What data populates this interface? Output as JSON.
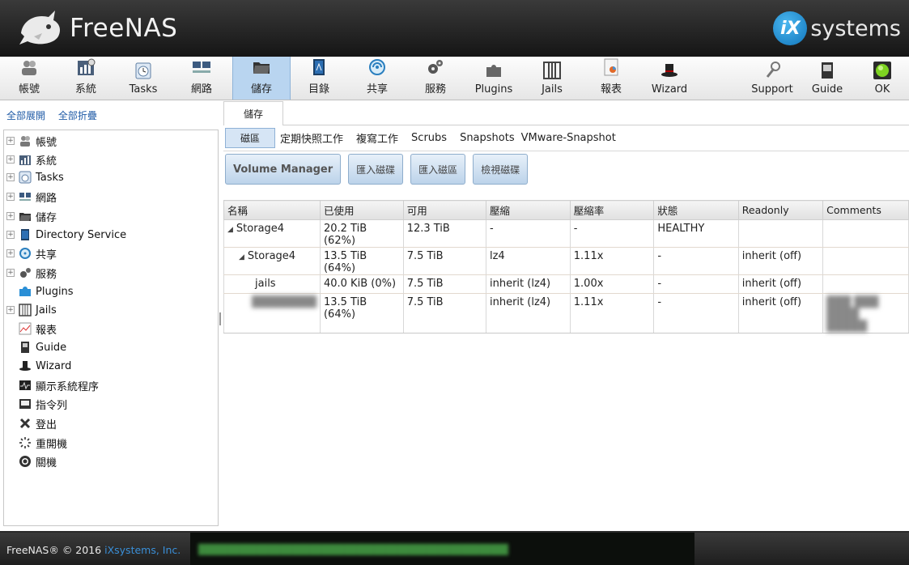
{
  "header": {
    "brand": "FreeNAS",
    "vendor_badge": "iX",
    "vendor_name": "systems"
  },
  "toolbar": {
    "items": [
      {
        "label": "帳號",
        "icon": "users-icon"
      },
      {
        "label": "系統",
        "icon": "system-icon"
      },
      {
        "label": "Tasks",
        "icon": "calendar-icon"
      },
      {
        "label": "網路",
        "icon": "network-icon"
      },
      {
        "label": "儲存",
        "icon": "folder-icon"
      },
      {
        "label": "目錄",
        "icon": "directory-icon"
      },
      {
        "label": "共享",
        "icon": "share-icon"
      },
      {
        "label": "服務",
        "icon": "gears-icon"
      },
      {
        "label": "Plugins",
        "icon": "puzzle-icon"
      },
      {
        "label": "Jails",
        "icon": "jail-icon"
      },
      {
        "label": "報表",
        "icon": "report-icon"
      },
      {
        "label": "Wizard",
        "icon": "wizard-hat-icon"
      },
      {
        "label": "Support",
        "icon": "support-icon"
      },
      {
        "label": "Guide",
        "icon": "guide-icon"
      },
      {
        "label": "OK",
        "icon": "alert-ok-icon"
      }
    ],
    "active": "儲存"
  },
  "sidebar": {
    "expand_all": "全部展開",
    "collapse_all": "全部折疊",
    "items": [
      {
        "label": "帳號",
        "expandable": true
      },
      {
        "label": "系統",
        "expandable": true
      },
      {
        "label": "Tasks",
        "expandable": true
      },
      {
        "label": "網路",
        "expandable": true
      },
      {
        "label": "儲存",
        "expandable": true
      },
      {
        "label": "Directory Service",
        "expandable": true
      },
      {
        "label": "共享",
        "expandable": true
      },
      {
        "label": "服務",
        "expandable": true
      },
      {
        "label": "Plugins",
        "expandable": false
      },
      {
        "label": "Jails",
        "expandable": true
      },
      {
        "label": "報表",
        "expandable": false
      },
      {
        "label": "Guide",
        "expandable": false
      },
      {
        "label": "Wizard",
        "expandable": false
      },
      {
        "label": "顯示系統程序",
        "expandable": false
      },
      {
        "label": "指令列",
        "expandable": false
      },
      {
        "label": "登出",
        "expandable": false
      },
      {
        "label": "重開機",
        "expandable": false
      },
      {
        "label": "關機",
        "expandable": false
      }
    ]
  },
  "main": {
    "tab": "儲存",
    "subtabs": [
      "磁區",
      "定期快照工作",
      "複寫工作",
      "Scrubs",
      "Snapshots",
      "VMware-Snapshot"
    ],
    "active_subtab": "磁區",
    "actions": [
      "Volume Manager",
      "匯入磁碟",
      "匯入磁區",
      "檢視磁碟"
    ],
    "table": {
      "columns": [
        "名稱",
        "已使用",
        "可用",
        "壓縮",
        "壓縮率",
        "狀態",
        "Readonly",
        "Comments"
      ],
      "rows": [
        {
          "name": "Storage4",
          "used": "20.2 TiB (62%)",
          "avail": "12.3 TiB",
          "compression": "-",
          "ratio": "-",
          "status": "HEALTHY",
          "readonly": "",
          "comments": ""
        },
        {
          "name": "Storage4",
          "used": "13.5 TiB (64%)",
          "avail": "7.5 TiB",
          "compression": "lz4",
          "ratio": "1.11x",
          "status": "-",
          "readonly": "inherit (off)",
          "comments": ""
        },
        {
          "name": "jails",
          "used": "40.0 KiB (0%)",
          "avail": "7.5 TiB",
          "compression": "inherit (lz4)",
          "ratio": "1.00x",
          "status": "-",
          "readonly": "inherit (off)",
          "comments": ""
        },
        {
          "name": "",
          "used": "13.5 TiB (64%)",
          "avail": "7.5 TiB",
          "compression": "inherit (lz4)",
          "ratio": "1.11x",
          "status": "-",
          "readonly": "inherit (off)",
          "comments": ""
        }
      ]
    }
  },
  "footer": {
    "copyright": "FreeNAS® © 2016",
    "company": "iXsystems, Inc."
  }
}
